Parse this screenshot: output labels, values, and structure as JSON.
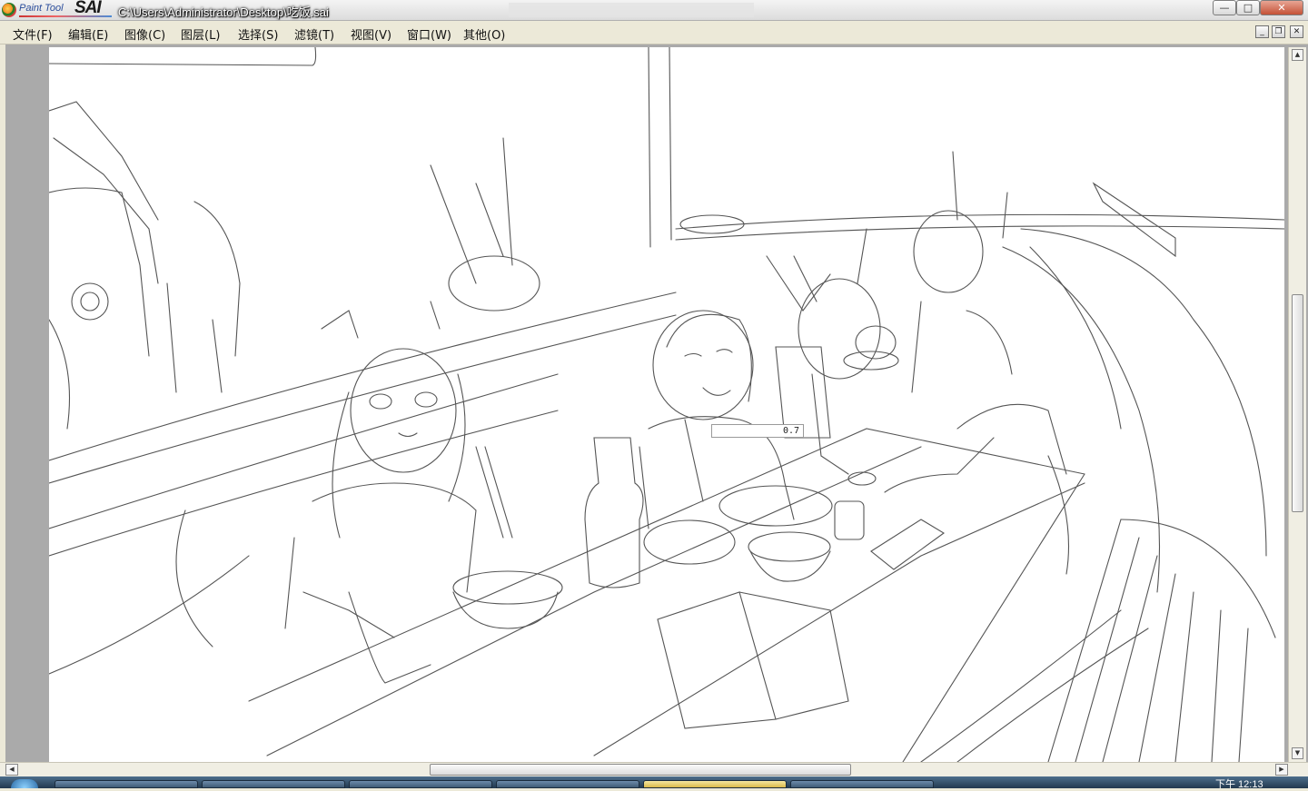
{
  "app": {
    "logo_small": "Paint Tool",
    "logo_large": "SAI",
    "window_title": "C:\\Users\\Administrator\\Desktop\\吃饭.sai"
  },
  "window_controls": {
    "minimize": "—",
    "maximize": "□",
    "close": "✕"
  },
  "menu": {
    "items": [
      {
        "label": "文件(F)"
      },
      {
        "label": "编辑(E)"
      },
      {
        "label": "图像(C)"
      },
      {
        "label": "图层(L)"
      },
      {
        "label": "选择(S)"
      },
      {
        "label": "滤镜(T)"
      },
      {
        "label": "视图(V)"
      },
      {
        "label": "窗口(W)"
      },
      {
        "label": "其他(O)"
      }
    ],
    "mdi_minimize": "_",
    "mdi_restore": "❐",
    "mdi_close": "✕"
  },
  "canvas": {
    "opacity_value": "0.7",
    "background_color": "#ffffff",
    "line_color": "#555555"
  },
  "scrollbars": {
    "up_arrow": "▲",
    "down_arrow": "▼",
    "left_arrow": "◀",
    "right_arrow": "▶"
  },
  "taskbar": {
    "clock": "下午 12:13"
  }
}
